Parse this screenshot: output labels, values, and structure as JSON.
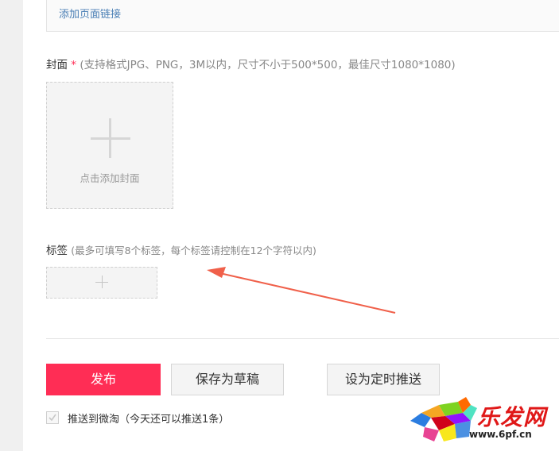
{
  "link": {
    "label": "添加页面链接"
  },
  "cover": {
    "label": "封面",
    "required_mark": "*",
    "hint": "(支持格式JPG、PNG，3M以内，尺寸不小于500*500，最佳尺寸1080*1080)",
    "upload_text": "点击添加封面",
    "upload_icon": "plus-icon"
  },
  "tags": {
    "label": "标签",
    "hint": "(最多可填写8个标签，每个标签请控制在12个字符以内)",
    "add_icon": "plus-icon"
  },
  "actions": {
    "publish": "发布",
    "save_draft": "保存为草稿",
    "schedule": "设为定时推送"
  },
  "weibo": {
    "checked": true,
    "label": "推送到微淘（今天还可以推送1条）"
  },
  "annotation": {
    "type": "arrow",
    "color": "#f0604a"
  },
  "watermark": {
    "brand": "乐发网",
    "url": "www.6pf.cn"
  },
  "colors": {
    "primary": "#ff2d55",
    "link": "#4a7fb5"
  }
}
